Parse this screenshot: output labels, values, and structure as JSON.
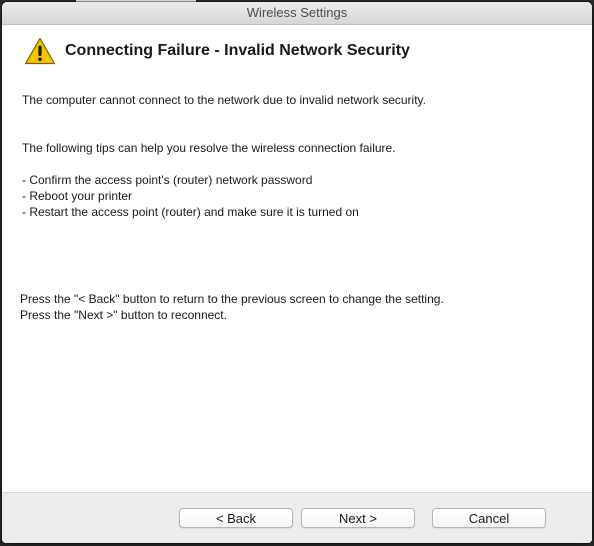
{
  "window": {
    "title": "Wireless Settings"
  },
  "header": {
    "icon": "warning-icon",
    "heading": "Connecting Failure - Invalid Network Security"
  },
  "body": {
    "description": "The computer cannot connect to the network due to invalid network security.",
    "tips_intro": "The following tips can help you resolve the wireless connection failure.",
    "tips": [
      "- Confirm the access point's (router) network password",
      "- Reboot your printer",
      "- Restart the access point (router) and make sure it is turned on"
    ],
    "instructions": [
      "Press the \"< Back\" button to return to the previous screen to change the setting.",
      "Press the \"Next >\" button to reconnect."
    ]
  },
  "buttons": {
    "back": "< Back",
    "next": "Next >",
    "cancel": "Cancel"
  },
  "colors": {
    "warning_fill": "#f5c400",
    "warning_stroke": "#7a6400"
  }
}
